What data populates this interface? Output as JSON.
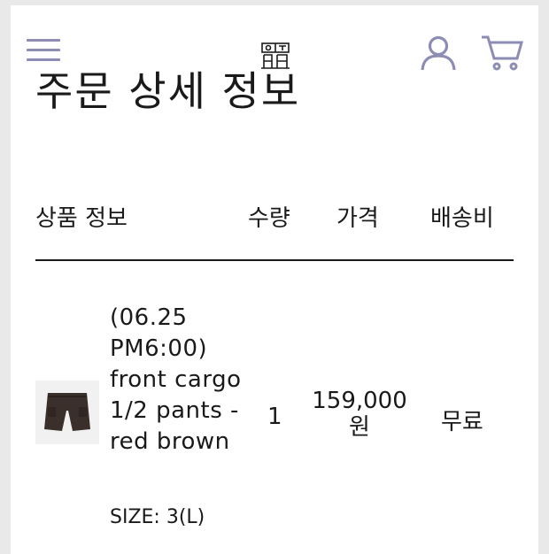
{
  "header": {
    "menu_icon": "hamburger-menu-icon",
    "logo_icon": "brand-logo-icon",
    "user_icon": "user-icon",
    "cart_icon": "cart-icon",
    "accent_color": "#8c8cb4"
  },
  "page": {
    "title": "주문 상세 정보"
  },
  "table": {
    "headers": {
      "product": "상품 정보",
      "quantity": "수량",
      "price": "가격",
      "shipping": "배송비"
    },
    "rows": [
      {
        "image_icon": "shorts-product-image",
        "name": "(06.25 PM6:00) front cargo 1/2 pants - red brown",
        "option": "SIZE: 3(L)",
        "quantity": "1",
        "price": "159,000 원",
        "shipping": "무료"
      }
    ]
  }
}
